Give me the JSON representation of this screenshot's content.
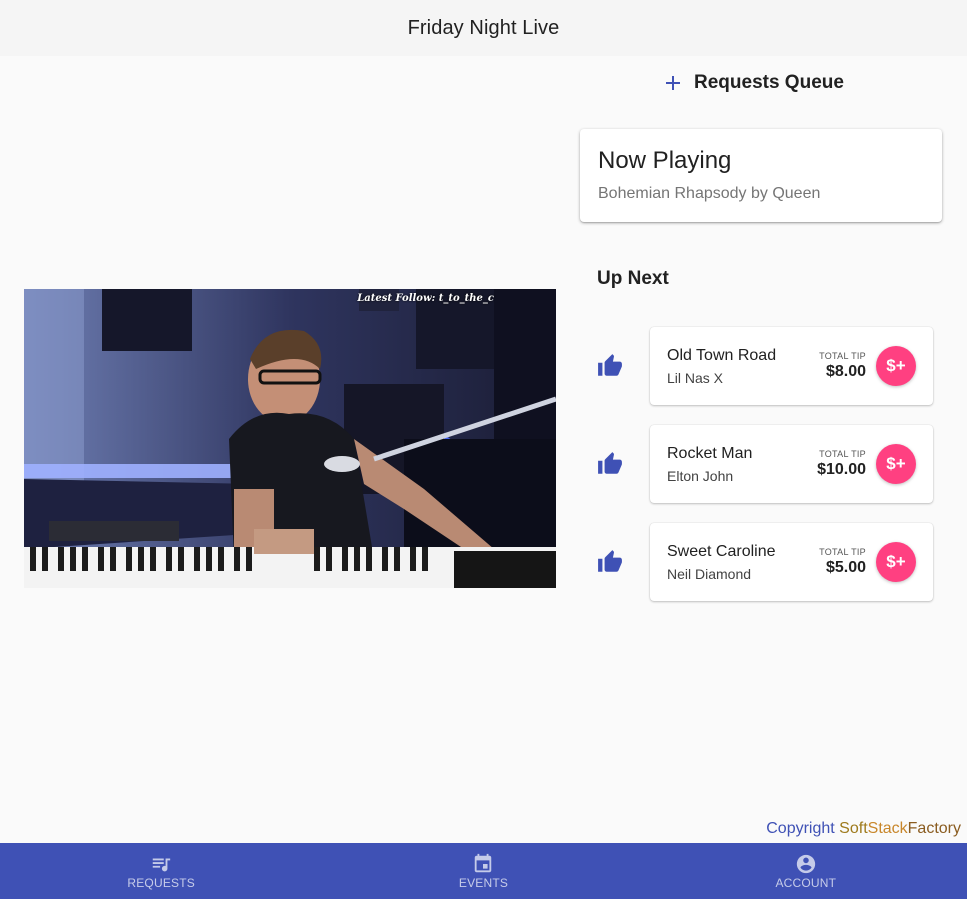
{
  "header": {
    "title": "Friday Night Live"
  },
  "video": {
    "overlay": "Latest Follow: t_to_the_c"
  },
  "queue": {
    "add_label": "Requests Queue"
  },
  "now_playing": {
    "heading": "Now Playing",
    "track": "Bohemian Rhapsody by Queen"
  },
  "up_next": {
    "heading": "Up Next",
    "tip_label": "TOTAL TIP",
    "tip_button": "$+",
    "items": [
      {
        "song": "Old Town Road",
        "artist": "Lil Nas X",
        "tip": "$8.00"
      },
      {
        "song": "Rocket Man",
        "artist": "Elton John",
        "tip": "$10.00"
      },
      {
        "song": "Sweet Caroline",
        "artist": "Neil Diamond",
        "tip": "$5.00"
      }
    ]
  },
  "footer": {
    "copyright": "Copyright",
    "brand_1": "Soft",
    "brand_2": "Stack",
    "brand_3": "Factory"
  },
  "nav": {
    "requests": "REQUESTS",
    "events": "EVENTS",
    "account": "ACCOUNT"
  },
  "colors": {
    "primary": "#3f51b5",
    "accent": "#ff4081",
    "header_bg": "#f5f5f5"
  },
  "icons": {
    "add": "plus-icon",
    "upvote": "thumb-up-icon",
    "requests": "queue-music-icon",
    "events": "calendar-icon",
    "account": "account-circle-icon"
  }
}
